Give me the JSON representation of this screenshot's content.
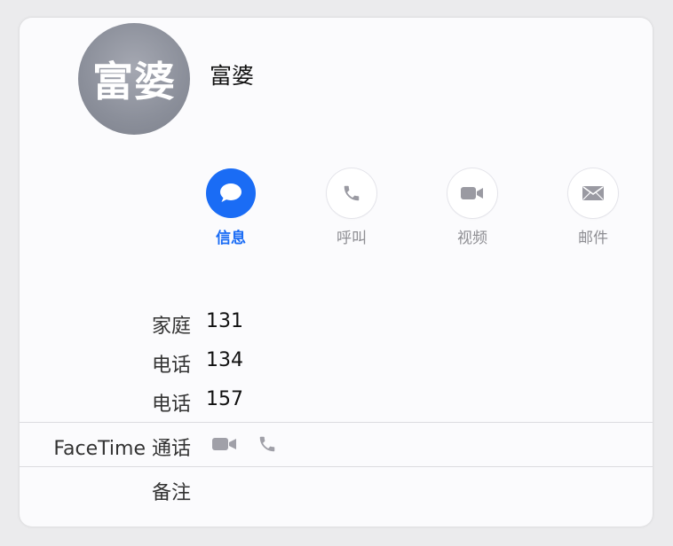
{
  "contact": {
    "avatar_text": "富婆",
    "name": "富婆"
  },
  "actions": [
    {
      "label": "信息",
      "icon": "message-bubble-icon"
    },
    {
      "label": "呼叫",
      "icon": "phone-icon"
    },
    {
      "label": "视频",
      "icon": "video-camera-icon"
    },
    {
      "label": "邮件",
      "icon": "envelope-icon"
    }
  ],
  "phones": [
    {
      "label": "家庭",
      "number": "131"
    },
    {
      "label": "电话",
      "number": "134"
    },
    {
      "label": "电话",
      "number": "157"
    }
  ],
  "facetime": {
    "label": "FaceTime 通话"
  },
  "notes": {
    "label": "备注"
  },
  "colors": {
    "accent": "#1a6cf5",
    "inactive": "#8e8e93",
    "icon_gray": "#a0a0a8"
  }
}
